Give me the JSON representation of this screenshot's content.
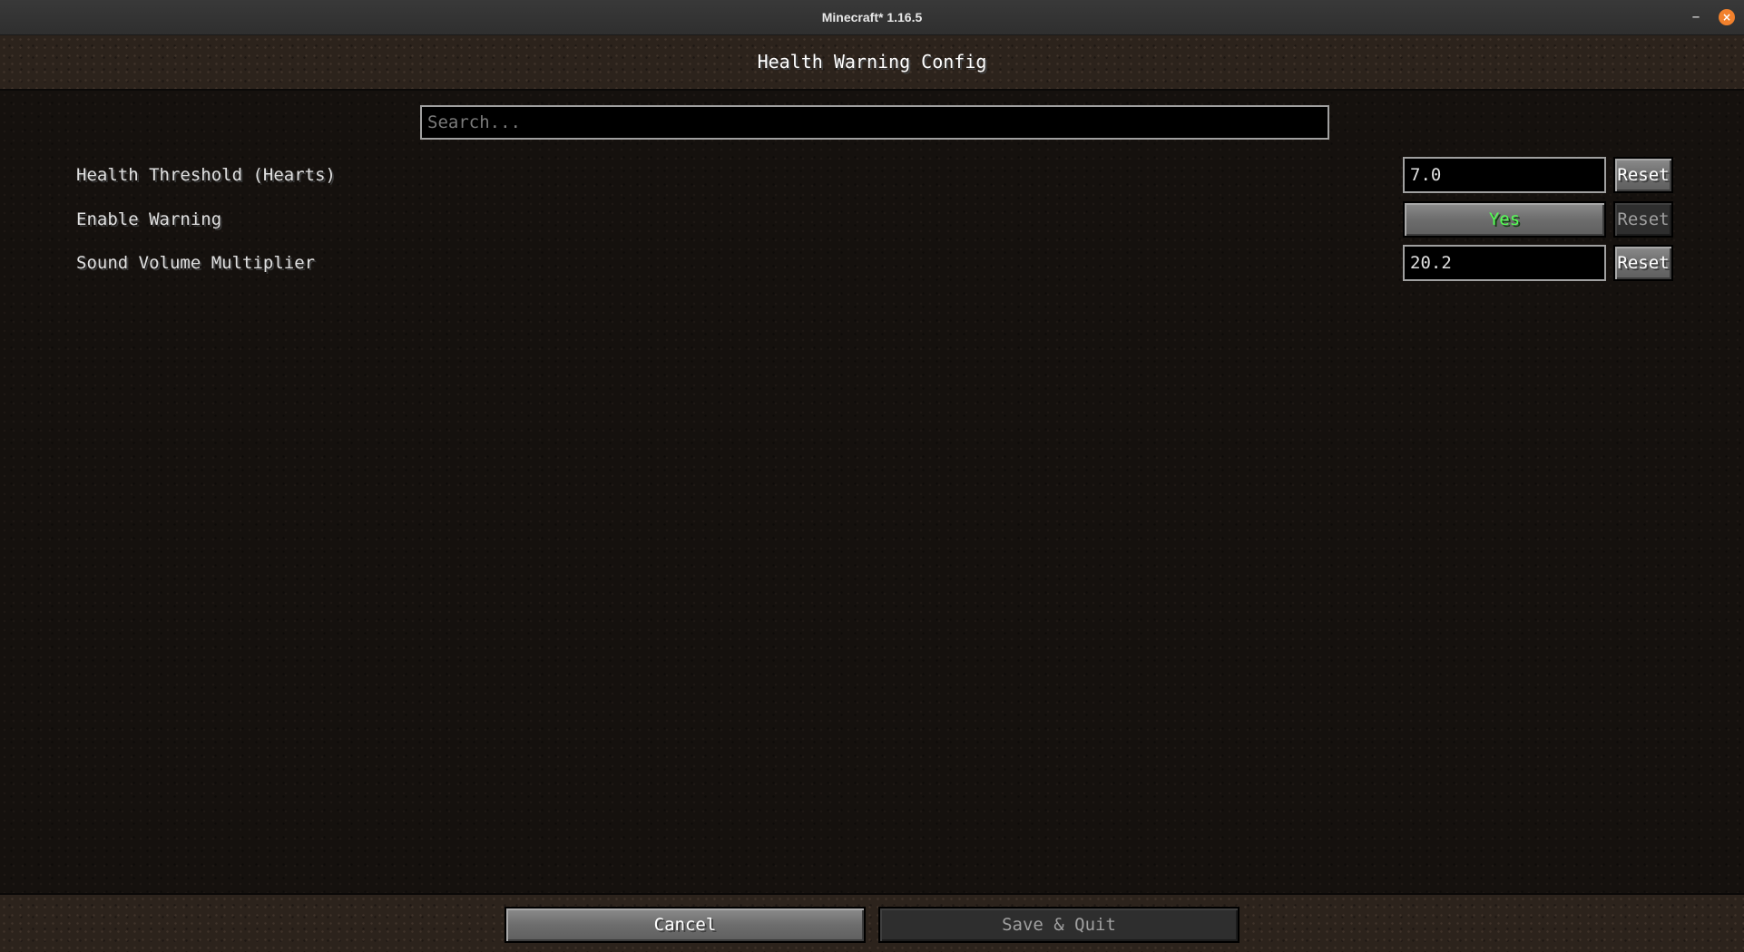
{
  "window": {
    "title": "Minecraft* 1.16.5",
    "minimize_glyph": "–",
    "close_glyph": "×",
    "close_color": "#f2812c"
  },
  "header": {
    "title": "Health Warning Config"
  },
  "search": {
    "placeholder": "Search...",
    "value": ""
  },
  "options": [
    {
      "label": "Health Threshold (Hearts)",
      "type": "text",
      "value": "7.0",
      "reset_label": "Reset",
      "reset_enabled": true
    },
    {
      "label": "Enable Warning",
      "type": "toggle",
      "value": "Yes",
      "reset_label": "Reset",
      "reset_enabled": false
    },
    {
      "label": "Sound Volume Multiplier",
      "type": "text",
      "value": "20.2",
      "reset_label": "Reset",
      "reset_enabled": true
    }
  ],
  "footer": {
    "cancel_label": "Cancel",
    "save_label": "Save & Quit",
    "save_enabled": false
  },
  "colors": {
    "toggle_on": "#55ff55",
    "button_disabled_text": "#a0a0a0"
  }
}
